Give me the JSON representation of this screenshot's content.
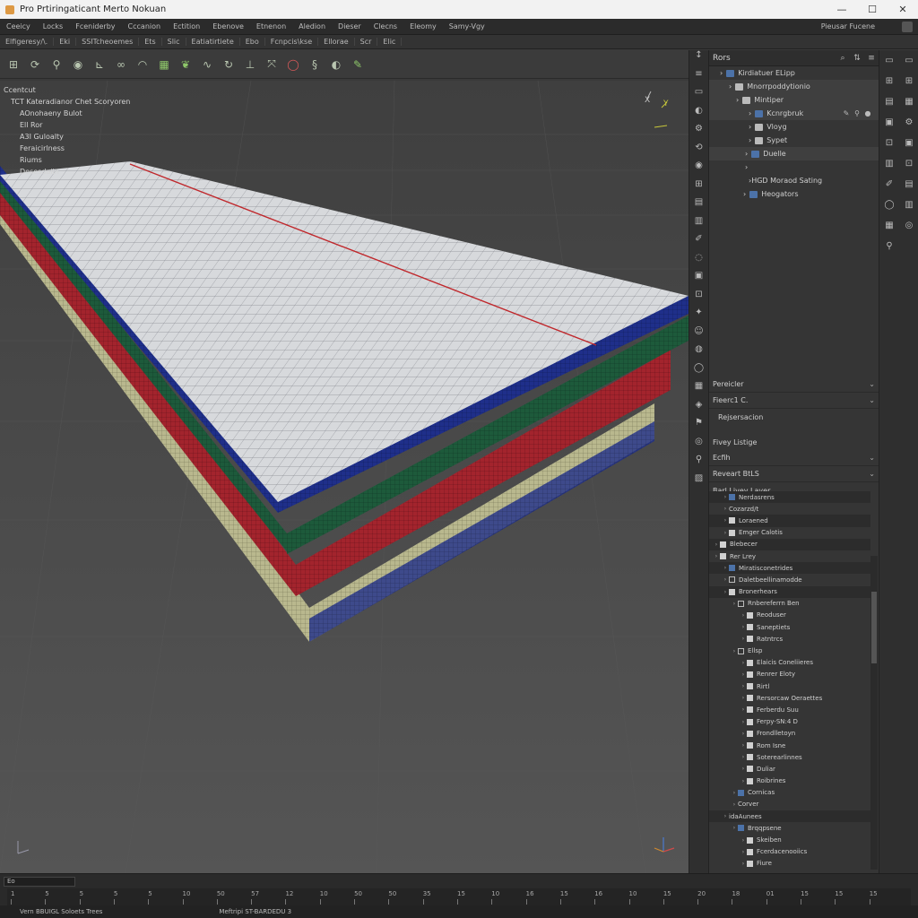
{
  "window": {
    "title": "Pro Prtiringaticant Merto Nokuan",
    "controls": [
      "—",
      "☐",
      "✕"
    ]
  },
  "menu": {
    "items": [
      "Ceeicy",
      "Locks",
      "Fceniderby",
      "Cccanion",
      "Ectition",
      "Ebenove",
      "Etnenon",
      "Aledion",
      "Dieser",
      "Clecns",
      "Eleomy",
      "Samy-Vgy"
    ],
    "right": "Pieusar Fucene"
  },
  "subbar": {
    "items": [
      "Elfigeresy/\\.",
      "Eki",
      "SSITcheoemes",
      "Ets",
      "Slic",
      "Eatiatirtiete",
      "Ebo",
      "Fcnpcis\\kse",
      "Ellorae",
      "Scr",
      "Elic"
    ]
  },
  "toolbar": {
    "icons": [
      "move-icon",
      "rotate-icon",
      "link-icon",
      "sphere-icon",
      "snap-icon",
      "loop-icon",
      "arc-icon",
      "grid-icon",
      "leaf-icon",
      "curve-icon",
      "refresh-icon",
      "axis-icon",
      "transform-icon",
      "circle-icon",
      "scale-icon",
      "half-icon",
      "pen-icon"
    ]
  },
  "viewport": {
    "menu": {
      "header": "Ccentcut",
      "sub": "TCT Kateradianor Chet Scoryoren",
      "items": [
        "AOnohaeny Bulot",
        "Ell Ror",
        "A3I Guloalty",
        "Feraicirlness",
        "Riums",
        "Desesdaiin"
      ]
    },
    "gizmo": {
      "x": "X",
      "y": "Y"
    },
    "colors": {
      "top": "#d7d9dc",
      "grid": "#7d8088",
      "blue": "#1f2f8a",
      "green": "#1d5a3b",
      "red": "#a3242d",
      "base": "#b9b88e",
      "guide": "#c0282c"
    }
  },
  "vtools": [
    "↕",
    "≡",
    "▭",
    "◐",
    "⚙",
    "⟲",
    "◉",
    "⊞",
    "▤",
    "▥",
    "✐",
    "◌",
    "▣",
    "⊡",
    "✦",
    "☺",
    "◍",
    "◯",
    "▦",
    "◈",
    "⚑",
    "◎",
    "⚲",
    "▨"
  ],
  "outliner": {
    "title": "Rors",
    "header_icons": [
      "⌕",
      "⇅",
      "≡"
    ],
    "rows": [
      {
        "label": "Kirdiatuer ELipp",
        "indent": 12,
        "icon": "b",
        "sel": false
      },
      {
        "label": "Mnorrpoddytionio",
        "indent": 22,
        "icon": "w",
        "sel": true
      },
      {
        "label": "Mintiper",
        "indent": 30,
        "icon": "w",
        "sel": true
      },
      {
        "label": "Kcnrgbruk",
        "indent": 44,
        "icon": "b",
        "sel": true
      },
      {
        "label": "Vloyg",
        "indent": 44,
        "icon": "w",
        "sel": false
      },
      {
        "label": "Sypet",
        "indent": 44,
        "icon": "w",
        "sel": false
      },
      {
        "label": "Duelle",
        "indent": 40,
        "icon": "b",
        "sel": true
      },
      {
        "label": "",
        "indent": 40,
        "icon": "",
        "sel": false
      },
      {
        "label": "HGD Moraod Sating",
        "indent": 44,
        "icon": "",
        "sel": false
      },
      {
        "label": "Heogators",
        "indent": 38,
        "icon": "b",
        "sel": false
      }
    ]
  },
  "properties": {
    "h1": "Pereicler",
    "h2": "Fieerc1 C.",
    "sub": "Rejsersacion",
    "h3": "Fivey Listige",
    "h4": "Ecfih",
    "h5": "Reveart BtLS",
    "h6": "Barl Livey Layer"
  },
  "tree": [
    {
      "t": "Nerdasrens",
      "lv": 1,
      "bx": "b",
      "hl": true
    },
    {
      "t": "Cozarzd/t",
      "lv": 1,
      "bx": "",
      "hl": false
    },
    {
      "t": "Loraened",
      "lv": 1,
      "bx": "w",
      "hl": true
    },
    {
      "t": "Emger Calotis",
      "lv": 1,
      "bx": "w",
      "hl": false
    },
    {
      "t": "Blebecer",
      "lv": 0,
      "bx": "w",
      "hl": true
    },
    {
      "t": "Rer Lrey",
      "lv": 0,
      "bx": "w",
      "hl": false
    },
    {
      "t": "Miratisconetrides",
      "lv": 1,
      "bx": "b",
      "hl": true
    },
    {
      "t": "Daletbeellinamodde",
      "lv": 1,
      "bx": "o",
      "hl": false
    },
    {
      "t": "Bronerhears",
      "lv": 1,
      "bx": "w",
      "hl": true
    },
    {
      "t": "Rnbereferrn Ben",
      "lv": 2,
      "bx": "o",
      "hl": false
    },
    {
      "t": "Reoduser",
      "lv": 3,
      "bx": "w",
      "hl": false
    },
    {
      "t": "Saneptiets",
      "lv": 3,
      "bx": "w",
      "hl": false
    },
    {
      "t": "Ratntrcs",
      "lv": 3,
      "bx": "w",
      "hl": false
    },
    {
      "t": "Ellsp",
      "lv": 2,
      "bx": "o",
      "hl": false
    },
    {
      "t": "Elaicis Coneliieres",
      "lv": 3,
      "bx": "w",
      "hl": false
    },
    {
      "t": "Renrer Eloty",
      "lv": 3,
      "bx": "w",
      "hl": false
    },
    {
      "t": "Rirtl",
      "lv": 3,
      "bx": "w",
      "hl": false
    },
    {
      "t": "Rersorcaw Oeraettes",
      "lv": 3,
      "bx": "w",
      "hl": false
    },
    {
      "t": "Ferberdu Suu",
      "lv": 3,
      "bx": "w",
      "hl": false
    },
    {
      "t": "Ferpy-SN:4 D",
      "lv": 3,
      "bx": "w",
      "hl": false
    },
    {
      "t": "Frondlletoyn",
      "lv": 3,
      "bx": "w",
      "hl": false
    },
    {
      "t": "Rom Isne",
      "lv": 3,
      "bx": "w",
      "hl": false
    },
    {
      "t": "Soterearlinnes",
      "lv": 3,
      "bx": "w",
      "hl": false
    },
    {
      "t": "Duliar",
      "lv": 3,
      "bx": "w",
      "hl": false
    },
    {
      "t": "Roibrines",
      "lv": 3,
      "bx": "w",
      "hl": false
    },
    {
      "t": "Cornicas",
      "lv": 2,
      "bx": "b",
      "hl": false
    },
    {
      "t": "Corver",
      "lv": 2,
      "bx": "",
      "hl": false
    },
    {
      "t": "idaAunees",
      "lv": 1,
      "bx": "",
      "hl": true
    },
    {
      "t": "Brqqpsene",
      "lv": 2,
      "bx": "b",
      "hl": false
    },
    {
      "t": "Skeiben",
      "lv": 3,
      "bx": "w",
      "hl": false
    },
    {
      "t": "Fcerdacenooiics",
      "lv": 3,
      "bx": "w",
      "hl": false
    },
    {
      "t": "Fiure",
      "lv": 3,
      "bx": "w",
      "hl": false
    }
  ],
  "farright": {
    "col1": [
      "▭",
      "⊞",
      "▤",
      "▣",
      "⊡",
      "▥",
      "✐",
      "◯",
      "▦",
      "⚲"
    ],
    "col2": [
      "▭",
      "⊞",
      "▦",
      "⚙",
      "▣",
      "⊡",
      "▤",
      "▥",
      "◎"
    ]
  },
  "timeline": {
    "field": "Eo",
    "ticks": [
      "1",
      "5",
      "5",
      "5",
      "5",
      "10",
      "50",
      "57",
      "12",
      "10",
      "50",
      "50",
      "35",
      "15",
      "10",
      "16",
      "15",
      "16",
      "10",
      "15",
      "20",
      "18",
      "01",
      "15",
      "15",
      "15"
    ]
  },
  "status": {
    "left": "Vern BBUIGL Soloets Trees",
    "mid": "Meftripi ST-BARDEDU 3"
  }
}
